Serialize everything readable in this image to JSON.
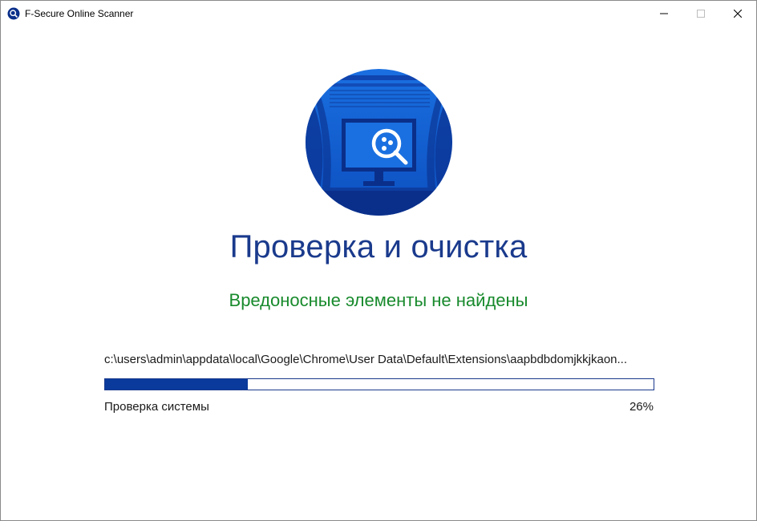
{
  "window": {
    "title": "F-Secure Online Scanner",
    "icon": "fsecure-scanner-icon",
    "controls": [
      "minimize",
      "maximize",
      "close"
    ]
  },
  "main": {
    "hero_icon": "monitor-magnifier-icon",
    "heading": "Проверка и очистка",
    "status": "Вредоносные элементы не найдены",
    "status_color": "#188a2c",
    "current_path": "c:\\users\\admin\\appdata\\local\\Google\\Chrome\\User Data\\Default\\Extensions\\aapbdbdomjkkjkaon...",
    "progress": {
      "label": "Проверка системы",
      "percent_text": "26%",
      "value": 0.26,
      "bar_color": "#0a3a9c"
    }
  },
  "colors": {
    "accent": "#1a3a8c",
    "hero_blue": "#1565d8"
  }
}
